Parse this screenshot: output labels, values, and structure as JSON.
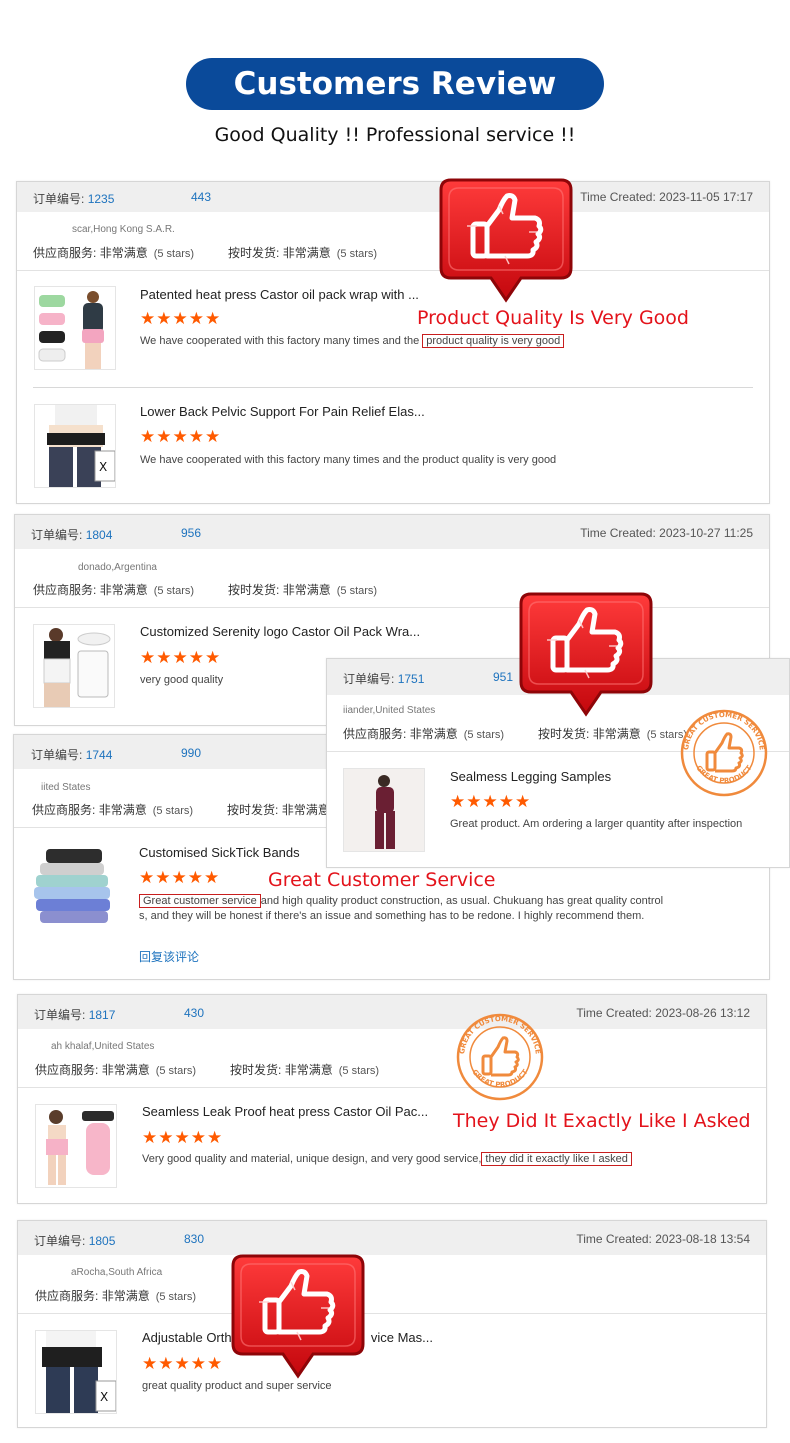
{
  "header": {
    "title": "Customers Review",
    "subtitle": "Good Quality !! Professional service !!"
  },
  "labels": {
    "order_no": "订单编号:",
    "time_created": "Time Created:",
    "supplier_service": "供应商服务:",
    "on_time_delivery": "按时发货:",
    "very_satisfied": "非常满意",
    "five_stars": "(5 stars)",
    "reply": "回复该评论",
    "stars_glyph": "★★★★★"
  },
  "callouts": {
    "quality": "Product Quality Is Very Good",
    "service": "Great Customer Service",
    "exactly": "They Did It Exactly Like I Asked"
  },
  "colors": {
    "brand_blue": "#0a4a9a",
    "link_blue": "#1e73be",
    "star_orange": "#ff5a00",
    "callout_red": "#e3131b",
    "stamp_orange": "#f08a3c"
  },
  "orders": [
    {
      "order_a": "1235",
      "order_b": "443",
      "time": "2023-11-05 17:17",
      "buyer": "scar,Hong Kong S.A.R.",
      "products": [
        {
          "title": "Patented heat press Castor oil pack wrap with ...",
          "review_pre": "We have cooperated with this factory many times and the",
          "review_box": "product quality is very good"
        },
        {
          "title": "Lower Back Pelvic Support For Pain Relief Elas...",
          "review": "We have cooperated with this factory many times and the product quality is very good"
        }
      ]
    },
    {
      "order_a": "1804",
      "order_b": "956",
      "time": "2023-10-27 11:25",
      "buyer": "donado,Argentina",
      "products": [
        {
          "title": "Customized Serenity logo Castor Oil Pack Wra...",
          "review": "very good quality"
        }
      ]
    },
    {
      "order_a": "1744",
      "order_b": "990",
      "buyer": "iited States",
      "products": [
        {
          "title": "Customised SickTick Bands",
          "review_box": "Great customer service",
          "review_line1": "and high quality product construction, as usual. Chukuang has great quality control",
          "review_line2": "s, and they will be honest if there's an issue and something has to be redone. I highly recommend them."
        }
      ]
    },
    {
      "order_a": "1751",
      "order_b": "951",
      "buyer": "iiander,United States",
      "products": [
        {
          "title": "Sealmess Legging Samples",
          "review": "Great product.  Am ordering a larger quantity after inspection"
        }
      ]
    },
    {
      "order_a": "1817",
      "order_b": "430",
      "time": "2023-08-26 13:12",
      "buyer": "ah khalaf,United States",
      "products": [
        {
          "title": "Seamless Leak Proof heat press Castor Oil Pac...",
          "review_pre": "Very good quality and material, unique design, and very good service,",
          "review_box": "they did it exactly like I asked"
        }
      ]
    },
    {
      "order_a": "1805",
      "order_b": "830",
      "time": "2023-08-18 13:54",
      "buyer": "aRocha,South Africa",
      "products": [
        {
          "title_a": "Adjustable Ortho",
          "title_b": "vice Mas...",
          "review": "great quality product and super service"
        }
      ]
    }
  ],
  "stamp_text": {
    "top": "GREAT CUSTOMER SERVICE",
    "bottom": "GREAT PRODUCT"
  }
}
